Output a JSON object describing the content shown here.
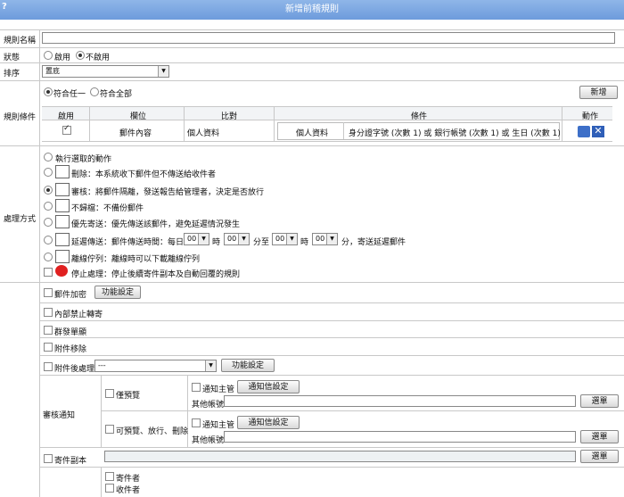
{
  "window": {
    "title": "新增前稽規則",
    "help": "?"
  },
  "form": {
    "rule_name_label": "規則名稱",
    "status_label": "狀態",
    "status_enable": "啟用",
    "status_disable": "不啟用",
    "order_label": "排序",
    "order_value": "置底"
  },
  "conditions": {
    "label": "規則條件",
    "match_any": "符合任一",
    "match_all": "符合全部",
    "add_button": "新增",
    "headers": [
      "啟用",
      "欄位",
      "比對",
      "條件",
      "動作"
    ],
    "row": {
      "field": "郵件內容",
      "compare": "個人資料",
      "cond_name": "個人資料",
      "cond_detail": "身分證字號 (次數 1) 或 銀行帳號 (次數 1) 或 生日 (次數 1)"
    }
  },
  "actions": {
    "label": "處理方式",
    "items": [
      "執行選取的動作",
      "刪除：本系統收下郵件但不傳送給收件者",
      "審核：將郵件隔離，發送報告給管理者，決定是否放行",
      "不歸檔：不備份郵件",
      "優先寄送：優先傳送該郵件，避免延遲情況發生",
      "延遲傳送：郵件傳送時間：",
      "離線佇列：離線時可以下載離線佇列",
      "停止處理：停止後續寄件副本及自動回覆的規則"
    ],
    "delay": {
      "every_day": "每日",
      "h1": "00",
      "hour": "時",
      "m1": "00",
      "to": "分至",
      "h2": "00",
      "m2": "00",
      "suffix": "分，寄送延遲郵件"
    }
  },
  "options": {
    "encrypt": "郵件加密",
    "func_btn": "功能設定",
    "no_forward": "內部禁止轉寄",
    "bulk": "群發單顯",
    "remove_attach": "附件移除",
    "attach_process": "附件後處理",
    "attach_select": "---",
    "review_notice": "審核通知",
    "preview_only": "僅預覽",
    "preview_release": "可預覽、放行、刪除",
    "notify_manager": "通知主管",
    "notify_setting": "通知信設定",
    "other_account": "其他帳號",
    "pick": "選單",
    "cc": "寄件副本",
    "sender": "寄件者",
    "recipient": "收件者"
  }
}
